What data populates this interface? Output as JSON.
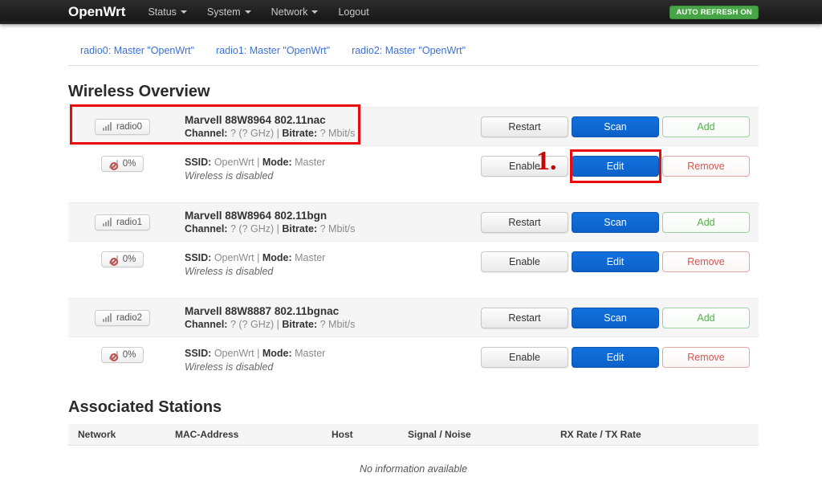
{
  "navbar": {
    "brand": "OpenWrt",
    "items": [
      {
        "label": "Status"
      },
      {
        "label": "System"
      },
      {
        "label": "Network"
      },
      {
        "label": "Logout"
      }
    ],
    "auto_refresh": "AUTO REFRESH ON"
  },
  "tabs": [
    {
      "label": "radio0: Master \"OpenWrt\""
    },
    {
      "label": "radio1: Master \"OpenWrt\""
    },
    {
      "label": "radio2: Master \"OpenWrt\""
    }
  ],
  "wireless": {
    "title": "Wireless Overview",
    "sep": "|",
    "radios": [
      {
        "name": "radio0",
        "device": "Marvell 88W8964 802.11nac",
        "channel_label": "Channel:",
        "channel_value": "? (? GHz)",
        "bitrate_label": "Bitrate:",
        "bitrate_value": "? Mbit/s",
        "signal": "0%",
        "ssid_label": "SSID:",
        "ssid_value": "OpenWrt",
        "mode_label": "Mode:",
        "mode_value": "Master",
        "status_note": "Wireless is disabled",
        "buttons": {
          "restart": "Restart",
          "scan": "Scan",
          "add": "Add",
          "enable": "Enable",
          "edit": "Edit",
          "remove": "Remove"
        }
      },
      {
        "name": "radio1",
        "device": "Marvell 88W8964 802.11bgn",
        "channel_label": "Channel:",
        "channel_value": "? (? GHz)",
        "bitrate_label": "Bitrate:",
        "bitrate_value": "? Mbit/s",
        "signal": "0%",
        "ssid_label": "SSID:",
        "ssid_value": "OpenWrt",
        "mode_label": "Mode:",
        "mode_value": "Master",
        "status_note": "Wireless is disabled",
        "buttons": {
          "restart": "Restart",
          "scan": "Scan",
          "add": "Add",
          "enable": "Enable",
          "edit": "Edit",
          "remove": "Remove"
        }
      },
      {
        "name": "radio2",
        "device": "Marvell 88W8887 802.11bgnac",
        "channel_label": "Channel:",
        "channel_value": "? (? GHz)",
        "bitrate_label": "Bitrate:",
        "bitrate_value": "? Mbit/s",
        "signal": "0%",
        "ssid_label": "SSID:",
        "ssid_value": "OpenWrt",
        "mode_label": "Mode:",
        "mode_value": "Master",
        "status_note": "Wireless is disabled",
        "buttons": {
          "restart": "Restart",
          "scan": "Scan",
          "add": "Add",
          "enable": "Enable",
          "edit": "Edit",
          "remove": "Remove"
        }
      }
    ]
  },
  "stations": {
    "title": "Associated Stations",
    "columns": [
      "Network",
      "MAC-Address",
      "Host",
      "Signal / Noise",
      "RX Rate / TX Rate"
    ],
    "empty_text": "No information available"
  },
  "annotations": {
    "step_label": "1."
  },
  "colors": {
    "primary_blue": "#0c61c9",
    "link_blue": "#3a70d6",
    "success_green": "#47a447",
    "danger_red": "#d9534f",
    "annotation_red": "#ea0c0c"
  }
}
